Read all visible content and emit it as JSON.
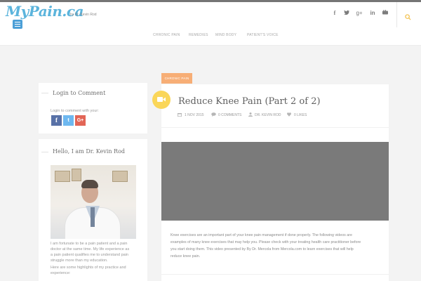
{
  "header": {
    "logo": "MyPain.ca",
    "byline": "by Dr. Kevin Rod",
    "nav": [
      "CHRONIC PAIN",
      "REMEDIES",
      "MIND BODY",
      "PATIENT'S VOICE"
    ],
    "social": [
      "f",
      "t",
      "g+",
      "in",
      "yt"
    ]
  },
  "sidebar": {
    "login_title": "Login to Comment",
    "login_text": "Login to comment with your:",
    "share_buttons": [
      {
        "label": "f",
        "color": "#3b5998"
      },
      {
        "label": "t",
        "color": "#55acee"
      },
      {
        "label": "G+",
        "color": "#dd4b39"
      }
    ],
    "about_title": "Hello, I am Dr. Kevin Rod",
    "about_lines": [
      "I am fortunate to be a pain patient and a pain",
      "doctor at the same time. My life experience as",
      "a pain patient qualifies me to understand pain",
      "struggle more than my education.",
      "Here are some highlights of my practice and",
      "experience:"
    ]
  },
  "post": {
    "category": "CHRONIC PAIN",
    "title": "Reduce Knee Pain (Part 2 of 2)",
    "date": "1 NOV 2015",
    "comments": "0 COMMENTS",
    "author": "DR. KEVIN ROD",
    "likes": "0 LIKES",
    "excerpt": [
      "Knee exercises are an important part of your knee pain management if done properly. The following videos are",
      "examples of many knee exercises that may help you. Please check with your treating health care practitioner before",
      "you start doing them. This video presented by By Dr. Mercola from Mercola.com to learn exercises that will help",
      "reduce knee pain."
    ]
  },
  "colors": {
    "accent_blue": "#3fa7d6",
    "category_orange": "#f6a05e",
    "video_badge": "#f9cf3c"
  }
}
